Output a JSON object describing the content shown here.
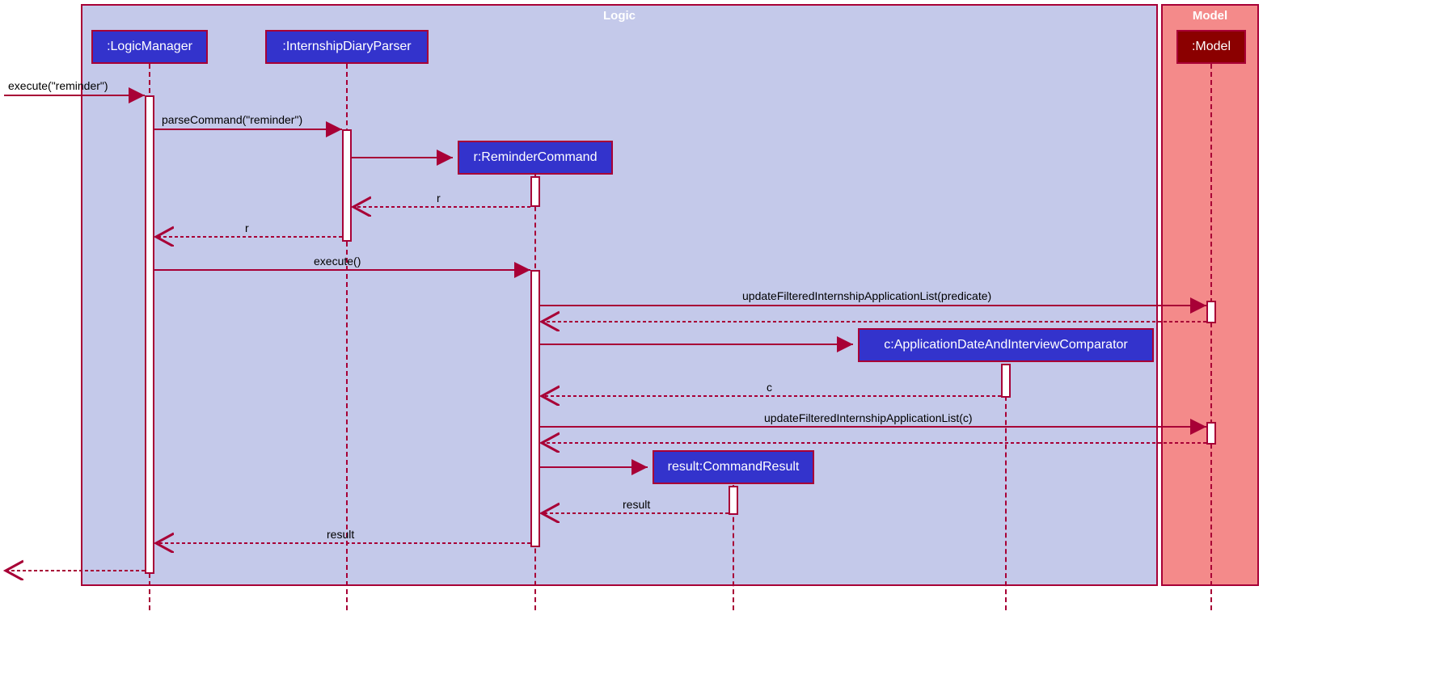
{
  "frames": {
    "logic": "Logic",
    "model": "Model"
  },
  "participants": {
    "logicManager": ":LogicManager",
    "parser": ":InternshipDiaryParser",
    "reminderCommand": "r:ReminderCommand",
    "comparator": "c:ApplicationDateAndInterviewComparator",
    "commandResult": "result:CommandResult",
    "model": ":Model"
  },
  "messages": {
    "execute_reminder": "execute(\"reminder\")",
    "parseCommand": "parseCommand(\"reminder\")",
    "return_r1": "r",
    "return_r2": "r",
    "execute": "execute()",
    "updateFiltered1": "updateFilteredInternshipApplicationList(predicate)",
    "return_c": "c",
    "updateFiltered2": "updateFilteredInternshipApplicationList(c)",
    "return_result1": "result",
    "return_result2": "result"
  },
  "chart_data": {
    "type": "sequence_diagram",
    "frames": [
      {
        "name": "Logic",
        "contains": [
          ":LogicManager",
          ":InternshipDiaryParser",
          "r:ReminderCommand",
          "c:ApplicationDateAndInterviewComparator",
          "result:CommandResult"
        ]
      },
      {
        "name": "Model",
        "contains": [
          ":Model"
        ]
      }
    ],
    "participants": [
      ":LogicManager",
      ":InternshipDiaryParser",
      "r:ReminderCommand",
      "c:ApplicationDateAndInterviewComparator",
      "result:CommandResult",
      ":Model"
    ],
    "messages": [
      {
        "from": "caller",
        "to": ":LogicManager",
        "label": "execute(\"reminder\")",
        "type": "call"
      },
      {
        "from": ":LogicManager",
        "to": ":InternshipDiaryParser",
        "label": "parseCommand(\"reminder\")",
        "type": "call"
      },
      {
        "from": ":InternshipDiaryParser",
        "to": "r:ReminderCommand",
        "label": "",
        "type": "create"
      },
      {
        "from": "r:ReminderCommand",
        "to": ":InternshipDiaryParser",
        "label": "r",
        "type": "return"
      },
      {
        "from": ":InternshipDiaryParser",
        "to": ":LogicManager",
        "label": "r",
        "type": "return"
      },
      {
        "from": ":LogicManager",
        "to": "r:ReminderCommand",
        "label": "execute()",
        "type": "call"
      },
      {
        "from": "r:ReminderCommand",
        "to": ":Model",
        "label": "updateFilteredInternshipApplicationList(predicate)",
        "type": "call"
      },
      {
        "from": ":Model",
        "to": "r:ReminderCommand",
        "label": "",
        "type": "return"
      },
      {
        "from": "r:ReminderCommand",
        "to": "c:ApplicationDateAndInterviewComparator",
        "label": "",
        "type": "create"
      },
      {
        "from": "c:ApplicationDateAndInterviewComparator",
        "to": "r:ReminderCommand",
        "label": "c",
        "type": "return"
      },
      {
        "from": "r:ReminderCommand",
        "to": ":Model",
        "label": "updateFilteredInternshipApplicationList(c)",
        "type": "call"
      },
      {
        "from": ":Model",
        "to": "r:ReminderCommand",
        "label": "",
        "type": "return"
      },
      {
        "from": "r:ReminderCommand",
        "to": "result:CommandResult",
        "label": "",
        "type": "create"
      },
      {
        "from": "result:CommandResult",
        "to": "r:ReminderCommand",
        "label": "result",
        "type": "return"
      },
      {
        "from": "r:ReminderCommand",
        "to": ":LogicManager",
        "label": "result",
        "type": "return"
      },
      {
        "from": ":LogicManager",
        "to": "caller",
        "label": "",
        "type": "return"
      }
    ]
  }
}
